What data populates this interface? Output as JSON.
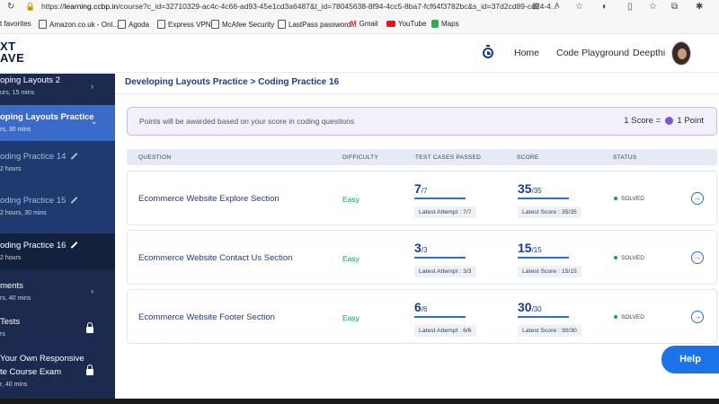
{
  "browser": {
    "url_prefix": "https://",
    "url_host": "learning.ccbp.in",
    "url_rest": "/course?c_id=32710329-ac4c-4c66-ad93-45e1cd3a6487&t_id=78045638-8f94-4cc5-8ba7-fcf64f3782bc&s_id=37d2cd89-cd24-4..."
  },
  "bookmarks": [
    "t favorites",
    "Amazon.co.uk - Onl...",
    "Agoda",
    "Express VPN",
    "McAfee Security",
    "LastPass password...",
    "Gmail",
    "YouTube",
    "Maps"
  ],
  "logo": {
    "line1": "XT",
    "line2": "AVE"
  },
  "header": {
    "home": "Home",
    "code_playground": "Code Playground",
    "user": "Deepthi"
  },
  "sidebar": {
    "items": [
      {
        "title": "oping Layouts 2",
        "sub": "urs, 15 mins"
      },
      {
        "title": "oping Layouts Practice",
        "sub": "rs, 30 mins"
      },
      {
        "title": "oding Practice 14",
        "sub": "2 hours"
      },
      {
        "title": "oding Practice 15",
        "sub": "2 hours, 30 mins"
      },
      {
        "title": "oding Practice 16",
        "sub": "2 hours"
      },
      {
        "title": "ments",
        "sub": "rs, 40 mins"
      },
      {
        "title": "Tests",
        "sub": "rs"
      },
      {
        "title": "Your Own Responsive",
        "title2": "te Course Exam",
        "sub": "r, 40 mins"
      }
    ]
  },
  "breadcrumb": "Developing Layouts Practice > Coding Practice 16",
  "points": {
    "text": "Points will be awarded based on your score in coding questions",
    "score_label": "1 Score =",
    "point_label": "1 Point"
  },
  "table": {
    "headers": {
      "question": "QUESTION",
      "difficulty": "DIFFICULTY",
      "tests": "TEST CASES PASSED",
      "score": "SCORE",
      "status": "STATUS"
    },
    "rows": [
      {
        "question": "Ecommerce Website Explore Section",
        "difficulty": "Easy",
        "tests_passed": "7",
        "tests_total": "/7",
        "attempt": "Latest Attempt : 7/7",
        "score": "35",
        "score_total": "/35",
        "latest_score": "Latest Score : 35/35",
        "status": "SOLVED"
      },
      {
        "question": "Ecommerce Website Contact Us Section",
        "difficulty": "Easy",
        "tests_passed": "3",
        "tests_total": "/3",
        "attempt": "Latest Attempt : 3/3",
        "score": "15",
        "score_total": "/15",
        "latest_score": "Latest Score : 15/15",
        "status": "SOLVED"
      },
      {
        "question": "Ecommerce Website Footer Section",
        "difficulty": "Easy",
        "tests_passed": "6",
        "tests_total": "/6",
        "attempt": "Latest Attempt : 6/6",
        "score": "30",
        "score_total": "/30",
        "latest_score": "Latest Score : 30/30",
        "status": "SOLVED"
      }
    ]
  },
  "help": "Help",
  "colors": {
    "sidebar": "#1b2a4e",
    "active": "#3b6bc9",
    "accent": "#1a73e8",
    "easy": "#16a34a"
  }
}
